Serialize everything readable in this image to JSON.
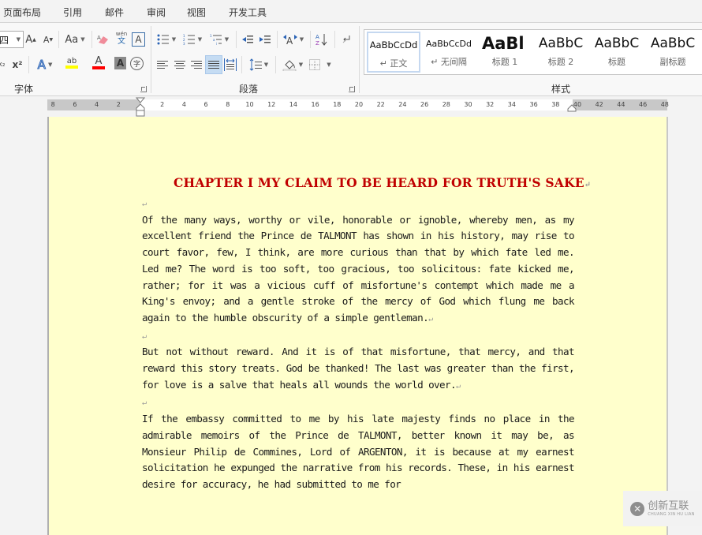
{
  "menu": {
    "tabs": [
      "页面布局",
      "引用",
      "邮件",
      "审阅",
      "视图",
      "开发工具"
    ]
  },
  "ribbon": {
    "font_group": {
      "label": "字体",
      "font_size_value": "四",
      "grow_font": "A",
      "shrink_font": "A",
      "change_case": "Aa",
      "phonetic_guide": "文",
      "char_border": "A",
      "subscript": "x₂",
      "superscript": "x²",
      "text_effect": "A",
      "highlight": "ab",
      "font_color": "A",
      "char_shading": "A",
      "enclose_char": "字",
      "colors": {
        "highlight": "#ffff00",
        "font_color": "#ff0000"
      }
    },
    "paragraph_group": {
      "label": "段落",
      "sort": "A↓",
      "active_alignment": "justify"
    },
    "styles_group": {
      "label": "样式",
      "styles": [
        {
          "sample": "AaBbCcDd",
          "name": "↵ 正文",
          "selected": true
        },
        {
          "sample": "AaBbCcDd",
          "name": "↵ 无间隔",
          "selected": false
        },
        {
          "sample": "AaBl",
          "name": "标题 1",
          "selected": false
        },
        {
          "sample": "AaBbC",
          "name": "标题 2",
          "selected": false
        },
        {
          "sample": "AaBbC",
          "name": "标题",
          "selected": false
        },
        {
          "sample": "AaBbC",
          "name": "副标题",
          "selected": false
        }
      ]
    }
  },
  "ruler": {
    "left_margin_ticks": [
      "8",
      "6",
      "4",
      "2"
    ],
    "body_ticks": [
      "2",
      "4",
      "6",
      "8",
      "10",
      "12",
      "14",
      "16",
      "18",
      "20",
      "22",
      "24",
      "26",
      "28",
      "30",
      "32",
      "34",
      "36",
      "38"
    ],
    "right_margin_ticks": [
      "40",
      "42",
      "44",
      "46",
      "48"
    ]
  },
  "document": {
    "title": "CHAPTER I MY CLAIM TO BE HEARD FOR TRUTH'S SAKE",
    "paragraph_mark": "↵",
    "paragraphs": [
      "Of the many ways, worthy or vile, honorable or ignoble, whereby men, as my excellent friend the Prince de TALMONT has shown in his history, may rise to court favor, few, I think, are more curious than that by which fate led me. Led me? The word is too soft, too gracious, too solicitous: fate kicked me, rather; for it was a vicious cuff of misfortune's contempt which made me a King's envoy; and a gentle stroke of the mercy of God which flung me back again to the humble obscurity of a simple gentleman.",
      "But not without reward. And it is of that misfortune, that mercy, and that reward this story treats. God be thanked! The last was greater than the first, for love is a salve that heals all wounds the world over.",
      "If the embassy committed to me by his late majesty finds no place in the admirable memoirs of the Prince de TALMONT, better known it may be, as Monsieur Philip de Commines, Lord of ARGENTON, it is because at my earnest solicitation he expunged the narrative from his records. These, in his earnest desire for accuracy, he had submitted to me for"
    ],
    "background_color": "#ffffcc",
    "title_color": "#c00000"
  },
  "watermark": {
    "text": "创新互联",
    "subtext": "CHUANG XIN HU LIAN"
  }
}
